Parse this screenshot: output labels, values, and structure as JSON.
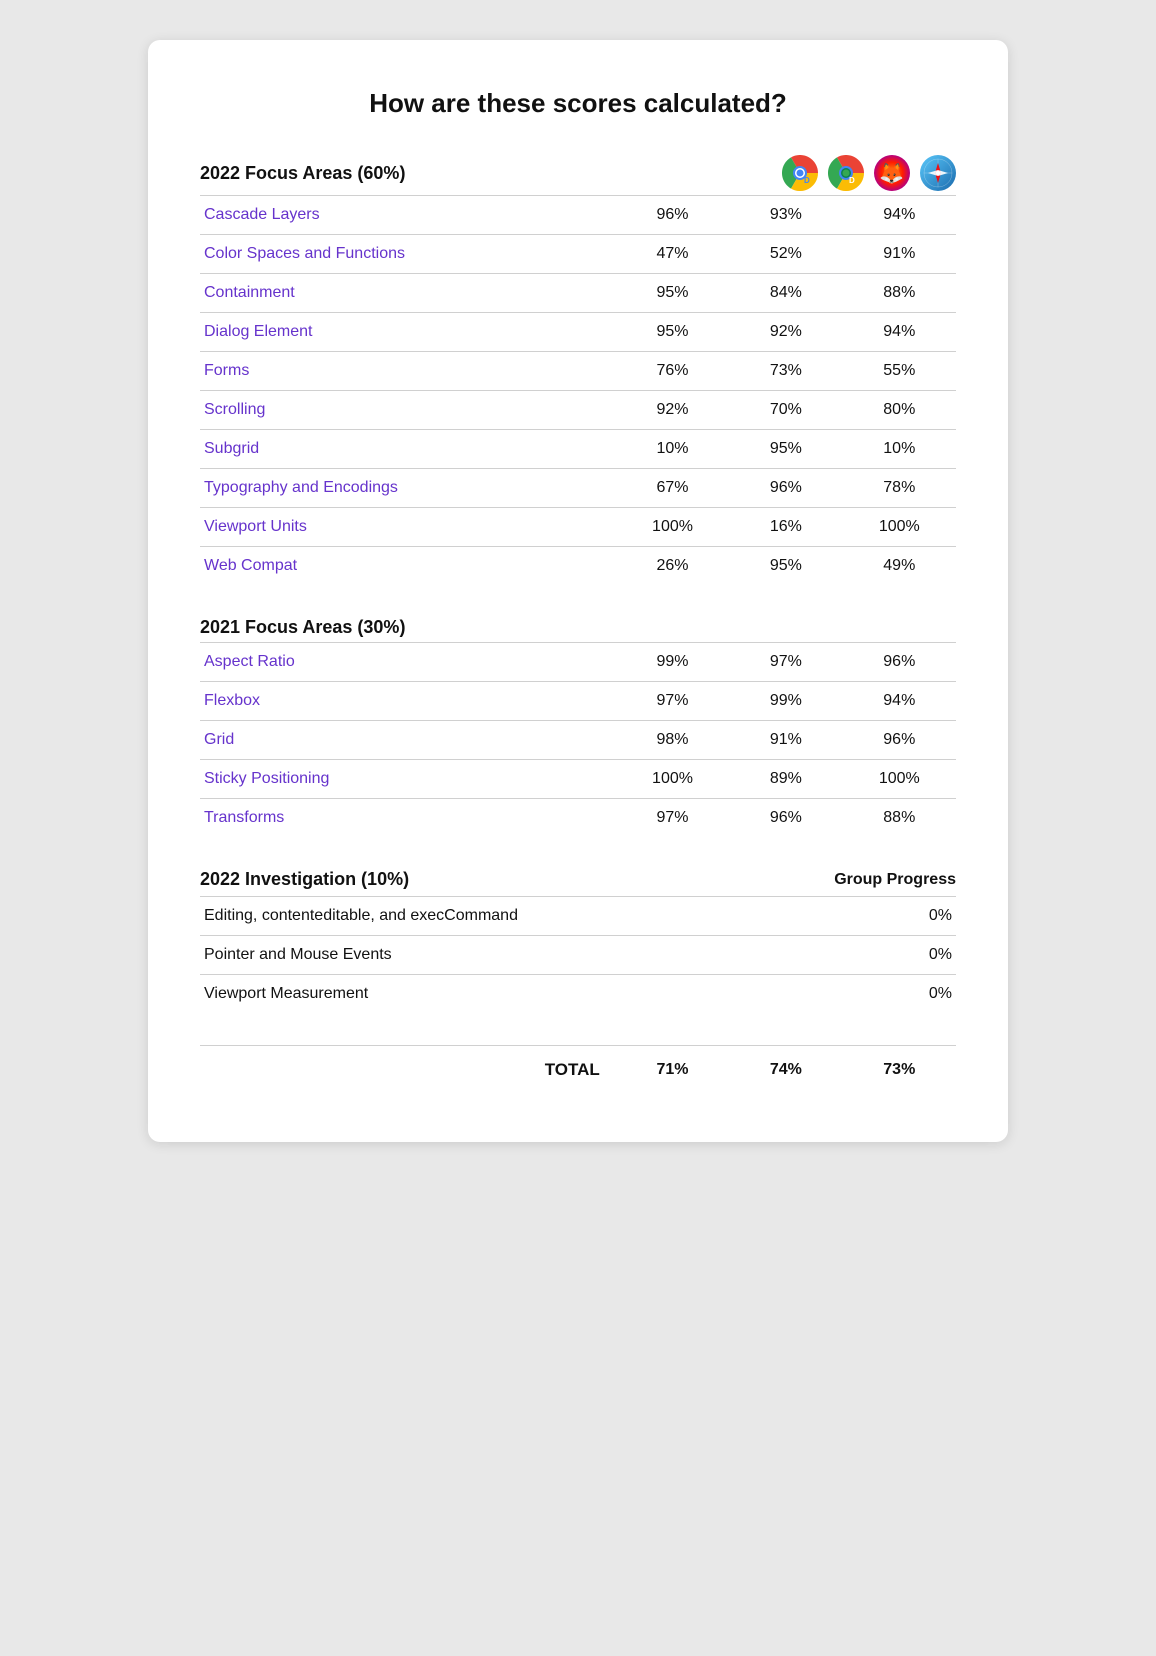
{
  "page": {
    "title": "How are these scores calculated?"
  },
  "section2022": {
    "title": "2022 Focus Areas (60%)",
    "browsers": [
      "chrome-dev",
      "firefox",
      "safari"
    ],
    "rows": [
      {
        "label": "Cascade Layers",
        "vals": [
          "96%",
          "93%",
          "94%"
        ],
        "link": true
      },
      {
        "label": "Color Spaces and Functions",
        "vals": [
          "47%",
          "52%",
          "91%"
        ],
        "link": true
      },
      {
        "label": "Containment",
        "vals": [
          "95%",
          "84%",
          "88%"
        ],
        "link": true
      },
      {
        "label": "Dialog Element",
        "vals": [
          "95%",
          "92%",
          "94%"
        ],
        "link": true
      },
      {
        "label": "Forms",
        "vals": [
          "76%",
          "73%",
          "55%"
        ],
        "link": true
      },
      {
        "label": "Scrolling",
        "vals": [
          "92%",
          "70%",
          "80%"
        ],
        "link": true
      },
      {
        "label": "Subgrid",
        "vals": [
          "10%",
          "95%",
          "10%"
        ],
        "link": true
      },
      {
        "label": "Typography and Encodings",
        "vals": [
          "67%",
          "96%",
          "78%"
        ],
        "link": true
      },
      {
        "label": "Viewport Units",
        "vals": [
          "100%",
          "16%",
          "100%"
        ],
        "link": true
      },
      {
        "label": "Web Compat",
        "vals": [
          "26%",
          "95%",
          "49%"
        ],
        "link": true
      }
    ]
  },
  "section2021": {
    "title": "2021 Focus Areas (30%)",
    "rows": [
      {
        "label": "Aspect Ratio",
        "vals": [
          "99%",
          "97%",
          "96%"
        ],
        "link": true
      },
      {
        "label": "Flexbox",
        "vals": [
          "97%",
          "99%",
          "94%"
        ],
        "link": true
      },
      {
        "label": "Grid",
        "vals": [
          "98%",
          "91%",
          "96%"
        ],
        "link": true
      },
      {
        "label": "Sticky Positioning",
        "vals": [
          "100%",
          "89%",
          "100%"
        ],
        "link": true
      },
      {
        "label": "Transforms",
        "vals": [
          "97%",
          "96%",
          "88%"
        ],
        "link": true
      }
    ]
  },
  "section2022inv": {
    "title": "2022 Investigation (10%)",
    "groupProgressLabel": "Group Progress",
    "rows": [
      {
        "label": "Editing, contenteditable, and execCommand",
        "val": "0%",
        "link": false
      },
      {
        "label": "Pointer and Mouse Events",
        "val": "0%",
        "link": false
      },
      {
        "label": "Viewport Measurement",
        "val": "0%",
        "link": false
      }
    ]
  },
  "total": {
    "label": "TOTAL",
    "vals": [
      "71%",
      "74%",
      "73%"
    ]
  }
}
